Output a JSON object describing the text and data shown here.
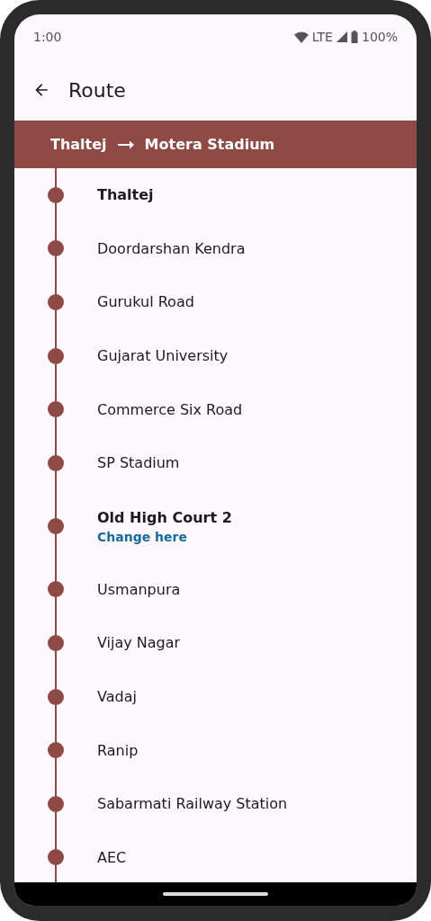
{
  "status_bar": {
    "time": "1:00",
    "network": "LTE",
    "battery": "100%"
  },
  "app_bar": {
    "title": "Route"
  },
  "route": {
    "from": "Thaltej",
    "to": "Motera Stadium"
  },
  "stations": [
    {
      "name": "Thaltej",
      "emphasized": true
    },
    {
      "name": "Doordarshan Kendra",
      "emphasized": false
    },
    {
      "name": "Gurukul Road",
      "emphasized": false
    },
    {
      "name": "Gujarat University",
      "emphasized": false
    },
    {
      "name": "Commerce Six Road",
      "emphasized": false
    },
    {
      "name": "SP Stadium",
      "emphasized": false
    },
    {
      "name": "Old High Court 2",
      "emphasized": true,
      "note": "Change here"
    },
    {
      "name": "Usmanpura",
      "emphasized": false
    },
    {
      "name": "Vijay Nagar",
      "emphasized": false
    },
    {
      "name": "Vadaj",
      "emphasized": false
    },
    {
      "name": "Ranip",
      "emphasized": false
    },
    {
      "name": "Sabarmati Railway Station",
      "emphasized": false
    },
    {
      "name": "AEC",
      "emphasized": false
    }
  ]
}
